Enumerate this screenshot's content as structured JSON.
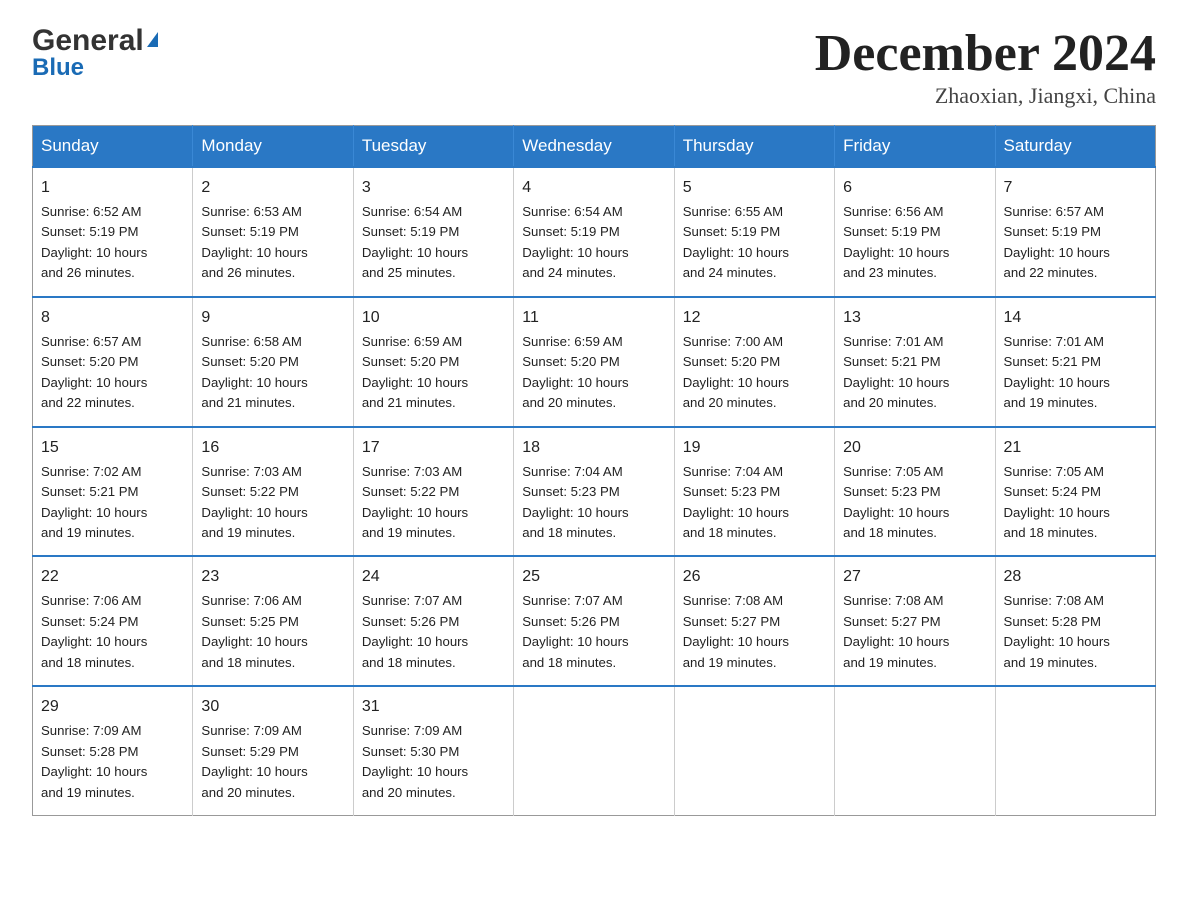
{
  "logo": {
    "general": "General",
    "blue": "Blue"
  },
  "title": "December 2024",
  "subtitle": "Zhaoxian, Jiangxi, China",
  "headers": [
    "Sunday",
    "Monday",
    "Tuesday",
    "Wednesday",
    "Thursday",
    "Friday",
    "Saturday"
  ],
  "weeks": [
    [
      {
        "day": "1",
        "info": "Sunrise: 6:52 AM\nSunset: 5:19 PM\nDaylight: 10 hours\nand 26 minutes."
      },
      {
        "day": "2",
        "info": "Sunrise: 6:53 AM\nSunset: 5:19 PM\nDaylight: 10 hours\nand 26 minutes."
      },
      {
        "day": "3",
        "info": "Sunrise: 6:54 AM\nSunset: 5:19 PM\nDaylight: 10 hours\nand 25 minutes."
      },
      {
        "day": "4",
        "info": "Sunrise: 6:54 AM\nSunset: 5:19 PM\nDaylight: 10 hours\nand 24 minutes."
      },
      {
        "day": "5",
        "info": "Sunrise: 6:55 AM\nSunset: 5:19 PM\nDaylight: 10 hours\nand 24 minutes."
      },
      {
        "day": "6",
        "info": "Sunrise: 6:56 AM\nSunset: 5:19 PM\nDaylight: 10 hours\nand 23 minutes."
      },
      {
        "day": "7",
        "info": "Sunrise: 6:57 AM\nSunset: 5:19 PM\nDaylight: 10 hours\nand 22 minutes."
      }
    ],
    [
      {
        "day": "8",
        "info": "Sunrise: 6:57 AM\nSunset: 5:20 PM\nDaylight: 10 hours\nand 22 minutes."
      },
      {
        "day": "9",
        "info": "Sunrise: 6:58 AM\nSunset: 5:20 PM\nDaylight: 10 hours\nand 21 minutes."
      },
      {
        "day": "10",
        "info": "Sunrise: 6:59 AM\nSunset: 5:20 PM\nDaylight: 10 hours\nand 21 minutes."
      },
      {
        "day": "11",
        "info": "Sunrise: 6:59 AM\nSunset: 5:20 PM\nDaylight: 10 hours\nand 20 minutes."
      },
      {
        "day": "12",
        "info": "Sunrise: 7:00 AM\nSunset: 5:20 PM\nDaylight: 10 hours\nand 20 minutes."
      },
      {
        "day": "13",
        "info": "Sunrise: 7:01 AM\nSunset: 5:21 PM\nDaylight: 10 hours\nand 20 minutes."
      },
      {
        "day": "14",
        "info": "Sunrise: 7:01 AM\nSunset: 5:21 PM\nDaylight: 10 hours\nand 19 minutes."
      }
    ],
    [
      {
        "day": "15",
        "info": "Sunrise: 7:02 AM\nSunset: 5:21 PM\nDaylight: 10 hours\nand 19 minutes."
      },
      {
        "day": "16",
        "info": "Sunrise: 7:03 AM\nSunset: 5:22 PM\nDaylight: 10 hours\nand 19 minutes."
      },
      {
        "day": "17",
        "info": "Sunrise: 7:03 AM\nSunset: 5:22 PM\nDaylight: 10 hours\nand 19 minutes."
      },
      {
        "day": "18",
        "info": "Sunrise: 7:04 AM\nSunset: 5:23 PM\nDaylight: 10 hours\nand 18 minutes."
      },
      {
        "day": "19",
        "info": "Sunrise: 7:04 AM\nSunset: 5:23 PM\nDaylight: 10 hours\nand 18 minutes."
      },
      {
        "day": "20",
        "info": "Sunrise: 7:05 AM\nSunset: 5:23 PM\nDaylight: 10 hours\nand 18 minutes."
      },
      {
        "day": "21",
        "info": "Sunrise: 7:05 AM\nSunset: 5:24 PM\nDaylight: 10 hours\nand 18 minutes."
      }
    ],
    [
      {
        "day": "22",
        "info": "Sunrise: 7:06 AM\nSunset: 5:24 PM\nDaylight: 10 hours\nand 18 minutes."
      },
      {
        "day": "23",
        "info": "Sunrise: 7:06 AM\nSunset: 5:25 PM\nDaylight: 10 hours\nand 18 minutes."
      },
      {
        "day": "24",
        "info": "Sunrise: 7:07 AM\nSunset: 5:26 PM\nDaylight: 10 hours\nand 18 minutes."
      },
      {
        "day": "25",
        "info": "Sunrise: 7:07 AM\nSunset: 5:26 PM\nDaylight: 10 hours\nand 18 minutes."
      },
      {
        "day": "26",
        "info": "Sunrise: 7:08 AM\nSunset: 5:27 PM\nDaylight: 10 hours\nand 19 minutes."
      },
      {
        "day": "27",
        "info": "Sunrise: 7:08 AM\nSunset: 5:27 PM\nDaylight: 10 hours\nand 19 minutes."
      },
      {
        "day": "28",
        "info": "Sunrise: 7:08 AM\nSunset: 5:28 PM\nDaylight: 10 hours\nand 19 minutes."
      }
    ],
    [
      {
        "day": "29",
        "info": "Sunrise: 7:09 AM\nSunset: 5:28 PM\nDaylight: 10 hours\nand 19 minutes."
      },
      {
        "day": "30",
        "info": "Sunrise: 7:09 AM\nSunset: 5:29 PM\nDaylight: 10 hours\nand 20 minutes."
      },
      {
        "day": "31",
        "info": "Sunrise: 7:09 AM\nSunset: 5:30 PM\nDaylight: 10 hours\nand 20 minutes."
      },
      {
        "day": "",
        "info": ""
      },
      {
        "day": "",
        "info": ""
      },
      {
        "day": "",
        "info": ""
      },
      {
        "day": "",
        "info": ""
      }
    ]
  ]
}
